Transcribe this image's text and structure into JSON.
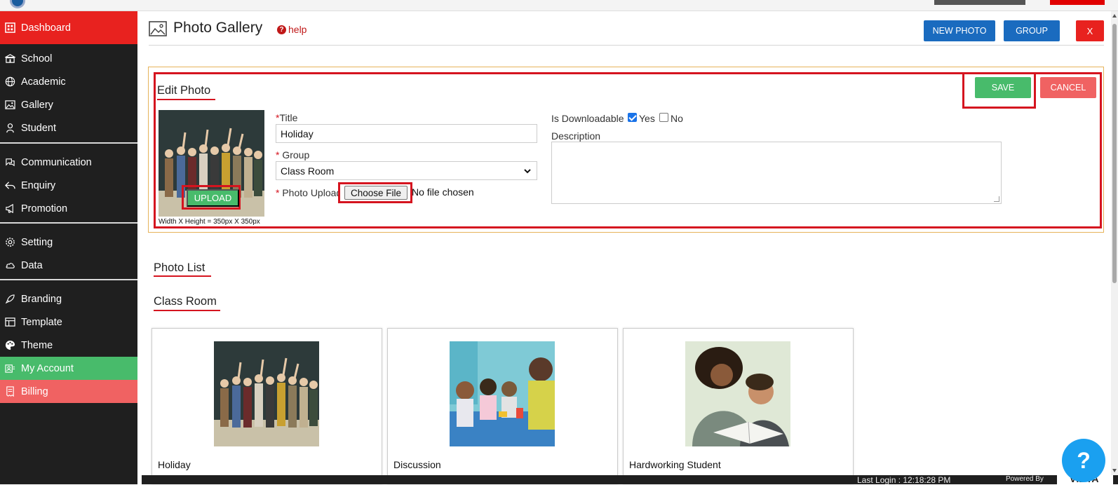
{
  "sidebar": {
    "items": [
      {
        "label": "Dashboard",
        "icon": "dashboard-icon"
      },
      {
        "label": "School",
        "icon": "school-icon"
      },
      {
        "label": "Academic",
        "icon": "globe-icon"
      },
      {
        "label": "Gallery",
        "icon": "image-icon"
      },
      {
        "label": "Student",
        "icon": "student-icon"
      },
      {
        "label": "Communication",
        "icon": "communication-icon"
      },
      {
        "label": "Enquiry",
        "icon": "reply-icon"
      },
      {
        "label": "Promotion",
        "icon": "megaphone-icon"
      },
      {
        "label": "Setting",
        "icon": "gear-icon"
      },
      {
        "label": "Data",
        "icon": "cloud-icon"
      },
      {
        "label": "Branding",
        "icon": "rocket-icon"
      },
      {
        "label": "Template",
        "icon": "template-icon"
      },
      {
        "label": "Theme",
        "icon": "palette-icon"
      },
      {
        "label": "My Account",
        "icon": "account-icon"
      },
      {
        "label": "Billing",
        "icon": "billing-icon"
      }
    ]
  },
  "header": {
    "title": "Photo Gallery",
    "help": "help",
    "new_photo": "NEW PHOTO",
    "group": "GROUP",
    "close": "X"
  },
  "edit": {
    "title": "Edit Photo",
    "save": "SAVE",
    "cancel": "CANCEL",
    "upload": "UPLOAD",
    "dims": "Width X Height = 350px X 350px",
    "title_label": "Title",
    "title_value": "Holiday",
    "group_label": "Group",
    "group_value": "Class Room",
    "photo_label": "Photo Upload",
    "choose_file": "Choose File",
    "no_file": "No file chosen",
    "downloadable_label": "Is Downloadable",
    "yes": "Yes",
    "no": "No",
    "description_label": "Description",
    "req": "*"
  },
  "list": {
    "title": "Photo List",
    "group_title": "Class Room",
    "cards": [
      {
        "caption": "Holiday"
      },
      {
        "caption": "Discussion"
      },
      {
        "caption": "Hardworking Student"
      }
    ]
  },
  "footer": {
    "login": "Last Login : 12:18:28 PM",
    "powered": "Powered By",
    "brand": "VIDYA"
  },
  "colors": {
    "sidebar_bg": "#1f1f1f",
    "active": "#e8221f",
    "account": "#48bb6b",
    "billing": "#f06262",
    "primary": "#1a6bbf",
    "highlight": "#d5141f"
  }
}
